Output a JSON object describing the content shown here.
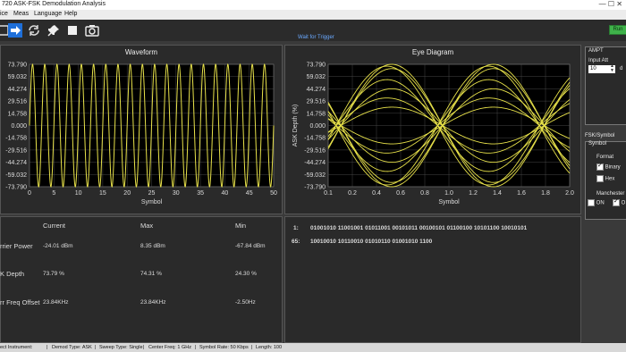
{
  "app": {
    "title": "720 ASK-FSK Demodulation Analysis",
    "window_controls": "—  ☐  ✕"
  },
  "menu": [
    "ice",
    "Meas",
    "Language",
    "Help"
  ],
  "toolbar": {
    "icons": [
      "settings-icon",
      "arrow-right-icon",
      "refresh-icon",
      "pin-icon",
      "stop-icon",
      "camera-icon"
    ],
    "trigger_status": "Wait for Trigger",
    "run_label": "Run"
  },
  "waveform": {
    "title": "Waveform",
    "xlabel": "Symbol",
    "yticks": [
      "73.790",
      "59.032",
      "44.274",
      "29.516",
      "14.758",
      "0.000",
      "-14.758",
      "-29.516",
      "-44.274",
      "-59.032",
      "-73.790"
    ],
    "xticks": [
      "0",
      "5",
      "10",
      "15",
      "20",
      "25",
      "30",
      "35",
      "40",
      "45",
      "50"
    ],
    "trace_color": "#e8e24a"
  },
  "eye": {
    "title": "Eye Diagram",
    "ylabel": "ASK Depth (%)",
    "xlabel": "Symbol",
    "yticks": [
      "73.790",
      "59.032",
      "44.274",
      "29.516",
      "14.758",
      "0.000",
      "-14.758",
      "-29.516",
      "-44.274",
      "-59.032",
      "-73.790"
    ],
    "xticks": [
      "0.1",
      "0.2",
      "0.4",
      "0.6",
      "0.8",
      "1.0",
      "1.2",
      "1.4",
      "1.6",
      "1.8",
      "2.0"
    ],
    "trace_color": "#e8e24a"
  },
  "chart_data": [
    {
      "type": "line",
      "title": "Waveform",
      "xlabel": "Symbol",
      "ylabel": "",
      "xlim": [
        0,
        50
      ],
      "ylim": [
        -73.79,
        73.79
      ],
      "grid": true,
      "series": [
        {
          "period_symbols": 2.5,
          "amplitude": 73.79
        }
      ]
    },
    {
      "type": "line",
      "title": "Eye Diagram",
      "xlabel": "Symbol",
      "ylabel": "ASK Depth (%)",
      "xlim": [
        0.1,
        2.0
      ],
      "ylim": [
        -73.79,
        73.79
      ],
      "grid": true,
      "series": [
        {
          "crossings_at_symbol": [
            0.2,
            1.0,
            1.8
          ],
          "amplitude": 73.79
        }
      ]
    }
  ],
  "measurements": {
    "headers": [
      "Current",
      "Max",
      "Min"
    ],
    "rows": [
      {
        "label": "rrier Power",
        "current": "-24.01 dBm",
        "max": "8.35 dBm",
        "min": "-67.84 dBm"
      },
      {
        "label": "K Depth",
        "current": "73.79 %",
        "max": "74.31 %",
        "min": "24.30 %"
      },
      {
        "label": "rr Freq Offset",
        "current": "23.84KHz",
        "max": "23.84KHz",
        "min": "-2.50Hz"
      }
    ]
  },
  "bits": [
    {
      "index": "1:",
      "value": "01001010 11001001 01011001 00101011 00100101 01100100 10101100 10010101"
    },
    {
      "index": "65:",
      "value": "10010010 10110010 01010110 01001010 1100"
    }
  ],
  "side": {
    "ampt_title": "AMPT",
    "input_att_label": "Input Att",
    "input_att_value": "10",
    "input_att_unit": "d",
    "fsk_title": "FSK/Symbol",
    "symbol_title": "Symbol",
    "format_label": "Format",
    "binary_label": "Binary",
    "hex_label": "Hex",
    "manchester_label": "Manchester",
    "on_label": "ON",
    "off_label": "O"
  },
  "status": {
    "instrument": "ect Instrument:",
    "demod": "Demod Type:  ASK",
    "sweep": "Sweep Type:  Single",
    "center": "Center Freq:  1 GHz",
    "rate": "Symbol Rate:  50 Kbps",
    "length": "Length:  100"
  }
}
